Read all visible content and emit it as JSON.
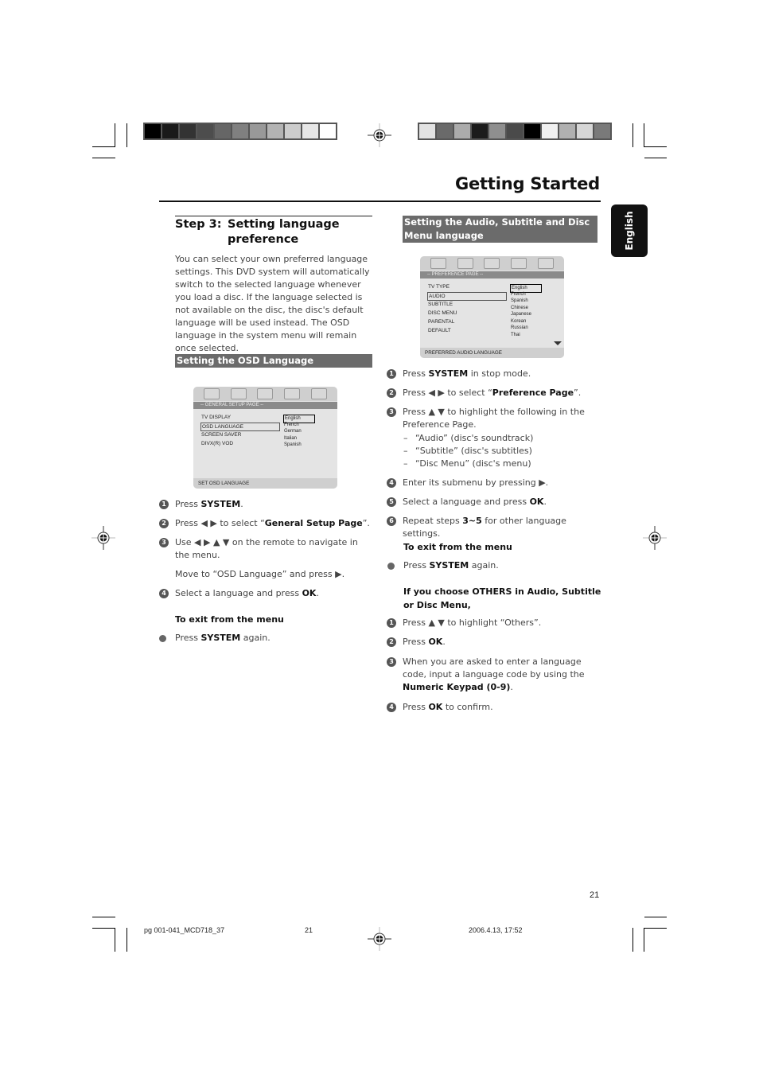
{
  "header": {
    "title": "Getting Started",
    "language_tab": "English",
    "colorbar_left": [
      "#000000",
      "#1a1a1a",
      "#333333",
      "#4d4d4d",
      "#666666",
      "#808080",
      "#999999",
      "#b3b3b3",
      "#cccccc",
      "#e6e6e6",
      "#ffffff"
    ],
    "colorbar_right": [
      "#e3e3e3",
      "#6a6a6a",
      "#ababab",
      "#1c1c1c",
      "#8f8f8f",
      "#4a4a4a",
      "#000000",
      "#f0f0f0",
      "#b0b0b0",
      "#d6d6d6",
      "#7a7a7a"
    ]
  },
  "left": {
    "step_num": "Step 3:",
    "step_title": "Setting language preference",
    "intro": "You can select your own preferred language settings. This DVD system will automatically switch to the selected language whenever you load a disc. If the language selected is not available on the disc, the disc's default language will be used instead. The OSD language in the system menu will remain once selected.",
    "banner": "Setting the OSD Language",
    "osd": {
      "page_label": "-- GENERAL SETUP PAGE --",
      "items": [
        "TV DISPLAY",
        "OSD LANGUAGE",
        "SCREEN SAVER",
        "DIVX(R) VOD"
      ],
      "selected_item": "OSD LANGUAGE",
      "options": [
        "English",
        "French",
        "German",
        "Italian",
        "Spanish"
      ],
      "selected_option": "English",
      "status": "SET OSD LANGUAGE",
      "icons": [
        "general-setup-icon",
        "audio-setup-icon",
        "dolby-icon",
        "preference-icon",
        "password-lock-icon"
      ]
    },
    "steps": [
      {
        "n": "1",
        "pre": "Press ",
        "bold": "SYSTEM",
        "post": "."
      },
      {
        "n": "2",
        "pre": "Press ◀ ▶ to select “",
        "bold": "General Setup Page",
        "post": "”."
      },
      {
        "n": "3",
        "pre": "Use ◀ ▶ ▲ ▼ on the remote to navigate in the menu.",
        "bold": "",
        "post": ""
      },
      {
        "n": "",
        "pre": "Move to “OSD Language” and press ▶.",
        "bold": "",
        "post": ""
      },
      {
        "n": "4",
        "pre": "Select a language and press ",
        "bold": "OK",
        "post": "."
      }
    ],
    "exit_heading": "To exit from the menu",
    "exit_step": {
      "pre": "Press ",
      "bold": "SYSTEM",
      "post": " again."
    }
  },
  "right": {
    "banner": "Setting the Audio, Subtitle and Disc Menu language",
    "osd": {
      "page_label": "-- PREFERENCE PAGE --",
      "items": [
        "TV TYPE",
        "AUDIO",
        "SUBTITLE",
        "DISC MENU",
        "PARENTAL",
        "DEFAULT"
      ],
      "selected_item": "AUDIO",
      "options": [
        "English",
        "French",
        "Spanish",
        "Chinese",
        "Japanese",
        "Korean",
        "Russian",
        "Thai"
      ],
      "selected_option": "English",
      "status": "PREFERRED AUDIO LANGUAGE",
      "icons": [
        "general-setup-icon",
        "audio-setup-icon",
        "dolby-icon",
        "preference-icon",
        "password-lock-icon"
      ]
    },
    "steps": [
      {
        "n": "1",
        "pre": "Press ",
        "bold": "SYSTEM",
        "post": " in stop mode."
      },
      {
        "n": "2",
        "pre": "Press ◀ ▶ to select “",
        "bold": "Preference Page",
        "post": "”."
      },
      {
        "n": "3",
        "pre": "Press ▲ ▼ to highlight the following in the Preference Page.",
        "bold": "",
        "post": ""
      },
      {
        "n": "4",
        "pre": "Enter its submenu by pressing ▶.",
        "bold": "",
        "post": ""
      },
      {
        "n": "5",
        "pre": "Select a language and press ",
        "bold": "OK",
        "post": "."
      },
      {
        "n": "6",
        "pre": "Repeat steps ",
        "bold": "3~5",
        "post": " for other language settings."
      }
    ],
    "sub_items": [
      "“Audio” (disc's soundtrack)",
      "“Subtitle” (disc's subtitles)",
      "“Disc Menu” (disc's menu)"
    ],
    "exit_heading": "To exit from the menu",
    "exit_step": {
      "pre": "Press ",
      "bold": "SYSTEM",
      "post": " again."
    },
    "others_heading": "If you choose OTHERS in Audio, Subtitle or Disc Menu,",
    "others_steps": [
      {
        "n": "1",
        "pre": "Press ▲ ▼ to highlight “Others”.",
        "bold": "",
        "post": ""
      },
      {
        "n": "2",
        "pre": "Press ",
        "bold": "OK",
        "post": "."
      },
      {
        "n": "3",
        "pre": "When you are asked to enter a language code, input a language code by using the ",
        "bold": "Numeric Keypad (0-9)",
        "post": "."
      },
      {
        "n": "4",
        "pre": "Press ",
        "bold": "OK",
        "post": " to confirm."
      }
    ]
  },
  "footer": {
    "page_number": "21",
    "file_name": "pg 001-041_MCD718_37",
    "slug_page": "21",
    "timestamp": "2006.4.13, 17:52"
  }
}
